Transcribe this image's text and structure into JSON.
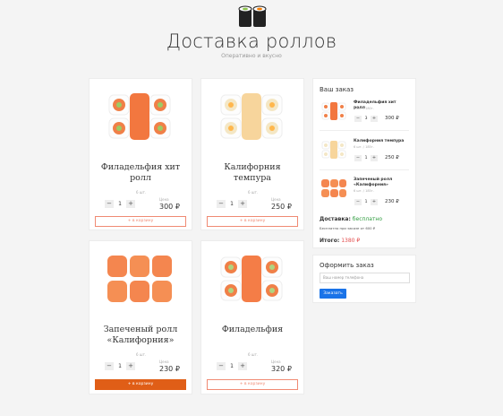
{
  "header": {
    "title": "Доставка роллов",
    "subtitle": "Оперативно и вкусно"
  },
  "products": [
    {
      "name": "Филадельфия хит ролл",
      "weight": "6 шт.",
      "price_label": "Цена",
      "price": "300 ₽",
      "qty": "1",
      "minus": "−",
      "plus": "+",
      "cart_label": "+ в корзину"
    },
    {
      "name": "Калифорния темпура",
      "weight": "6 шт.",
      "price_label": "Цена",
      "price": "250 ₽",
      "qty": "1",
      "minus": "−",
      "plus": "+",
      "cart_label": "+ в корзину"
    },
    {
      "name": "Запеченый ролл «Калифорния»",
      "weight": "6 шт.",
      "price_label": "Цена",
      "price": "230 ₽",
      "qty": "1",
      "minus": "−",
      "plus": "+",
      "cart_label": "+ в корзину"
    },
    {
      "name": "Филадельфия",
      "weight": "6 шт.",
      "price_label": "Цена",
      "price": "320 ₽",
      "qty": "1",
      "minus": "−",
      "plus": "+",
      "cart_label": "+ в корзину"
    }
  ],
  "cart": {
    "title": "Ваш заказ",
    "items": [
      {
        "name": "Филадельфия хит ролл",
        "weight": "6 шт. / 180г.",
        "qty": "3",
        "price": "300 ₽",
        "minus": "−",
        "plus": "+"
      },
      {
        "name": "Калифорния темпура",
        "weight": "6 шт. / 185г.",
        "qty": "1",
        "price": "250 ₽",
        "minus": "−",
        "plus": "+"
      },
      {
        "name": "Запеченый ролл «Калифорния»",
        "weight": "6 шт. / 185г.",
        "qty": "1",
        "price": "230 ₽",
        "minus": "−",
        "plus": "+"
      }
    ],
    "delivery_label": "Доставка:",
    "delivery_value": "бесплатно",
    "delivery_note": "Бесплатно при заказе от 600 ₽",
    "total_label": "Итого:",
    "total_value": "1380 ₽"
  },
  "checkout": {
    "title": "Оформить заказ",
    "phone_placeholder": "Ваш номер телефона",
    "submit_label": "Заказать"
  },
  "colors": {
    "accent": "#e05e17",
    "outline": "#f08a73",
    "button_blue": "#1a73e8",
    "free_green": "#2e9b3e",
    "total_red": "#e34e4e"
  }
}
